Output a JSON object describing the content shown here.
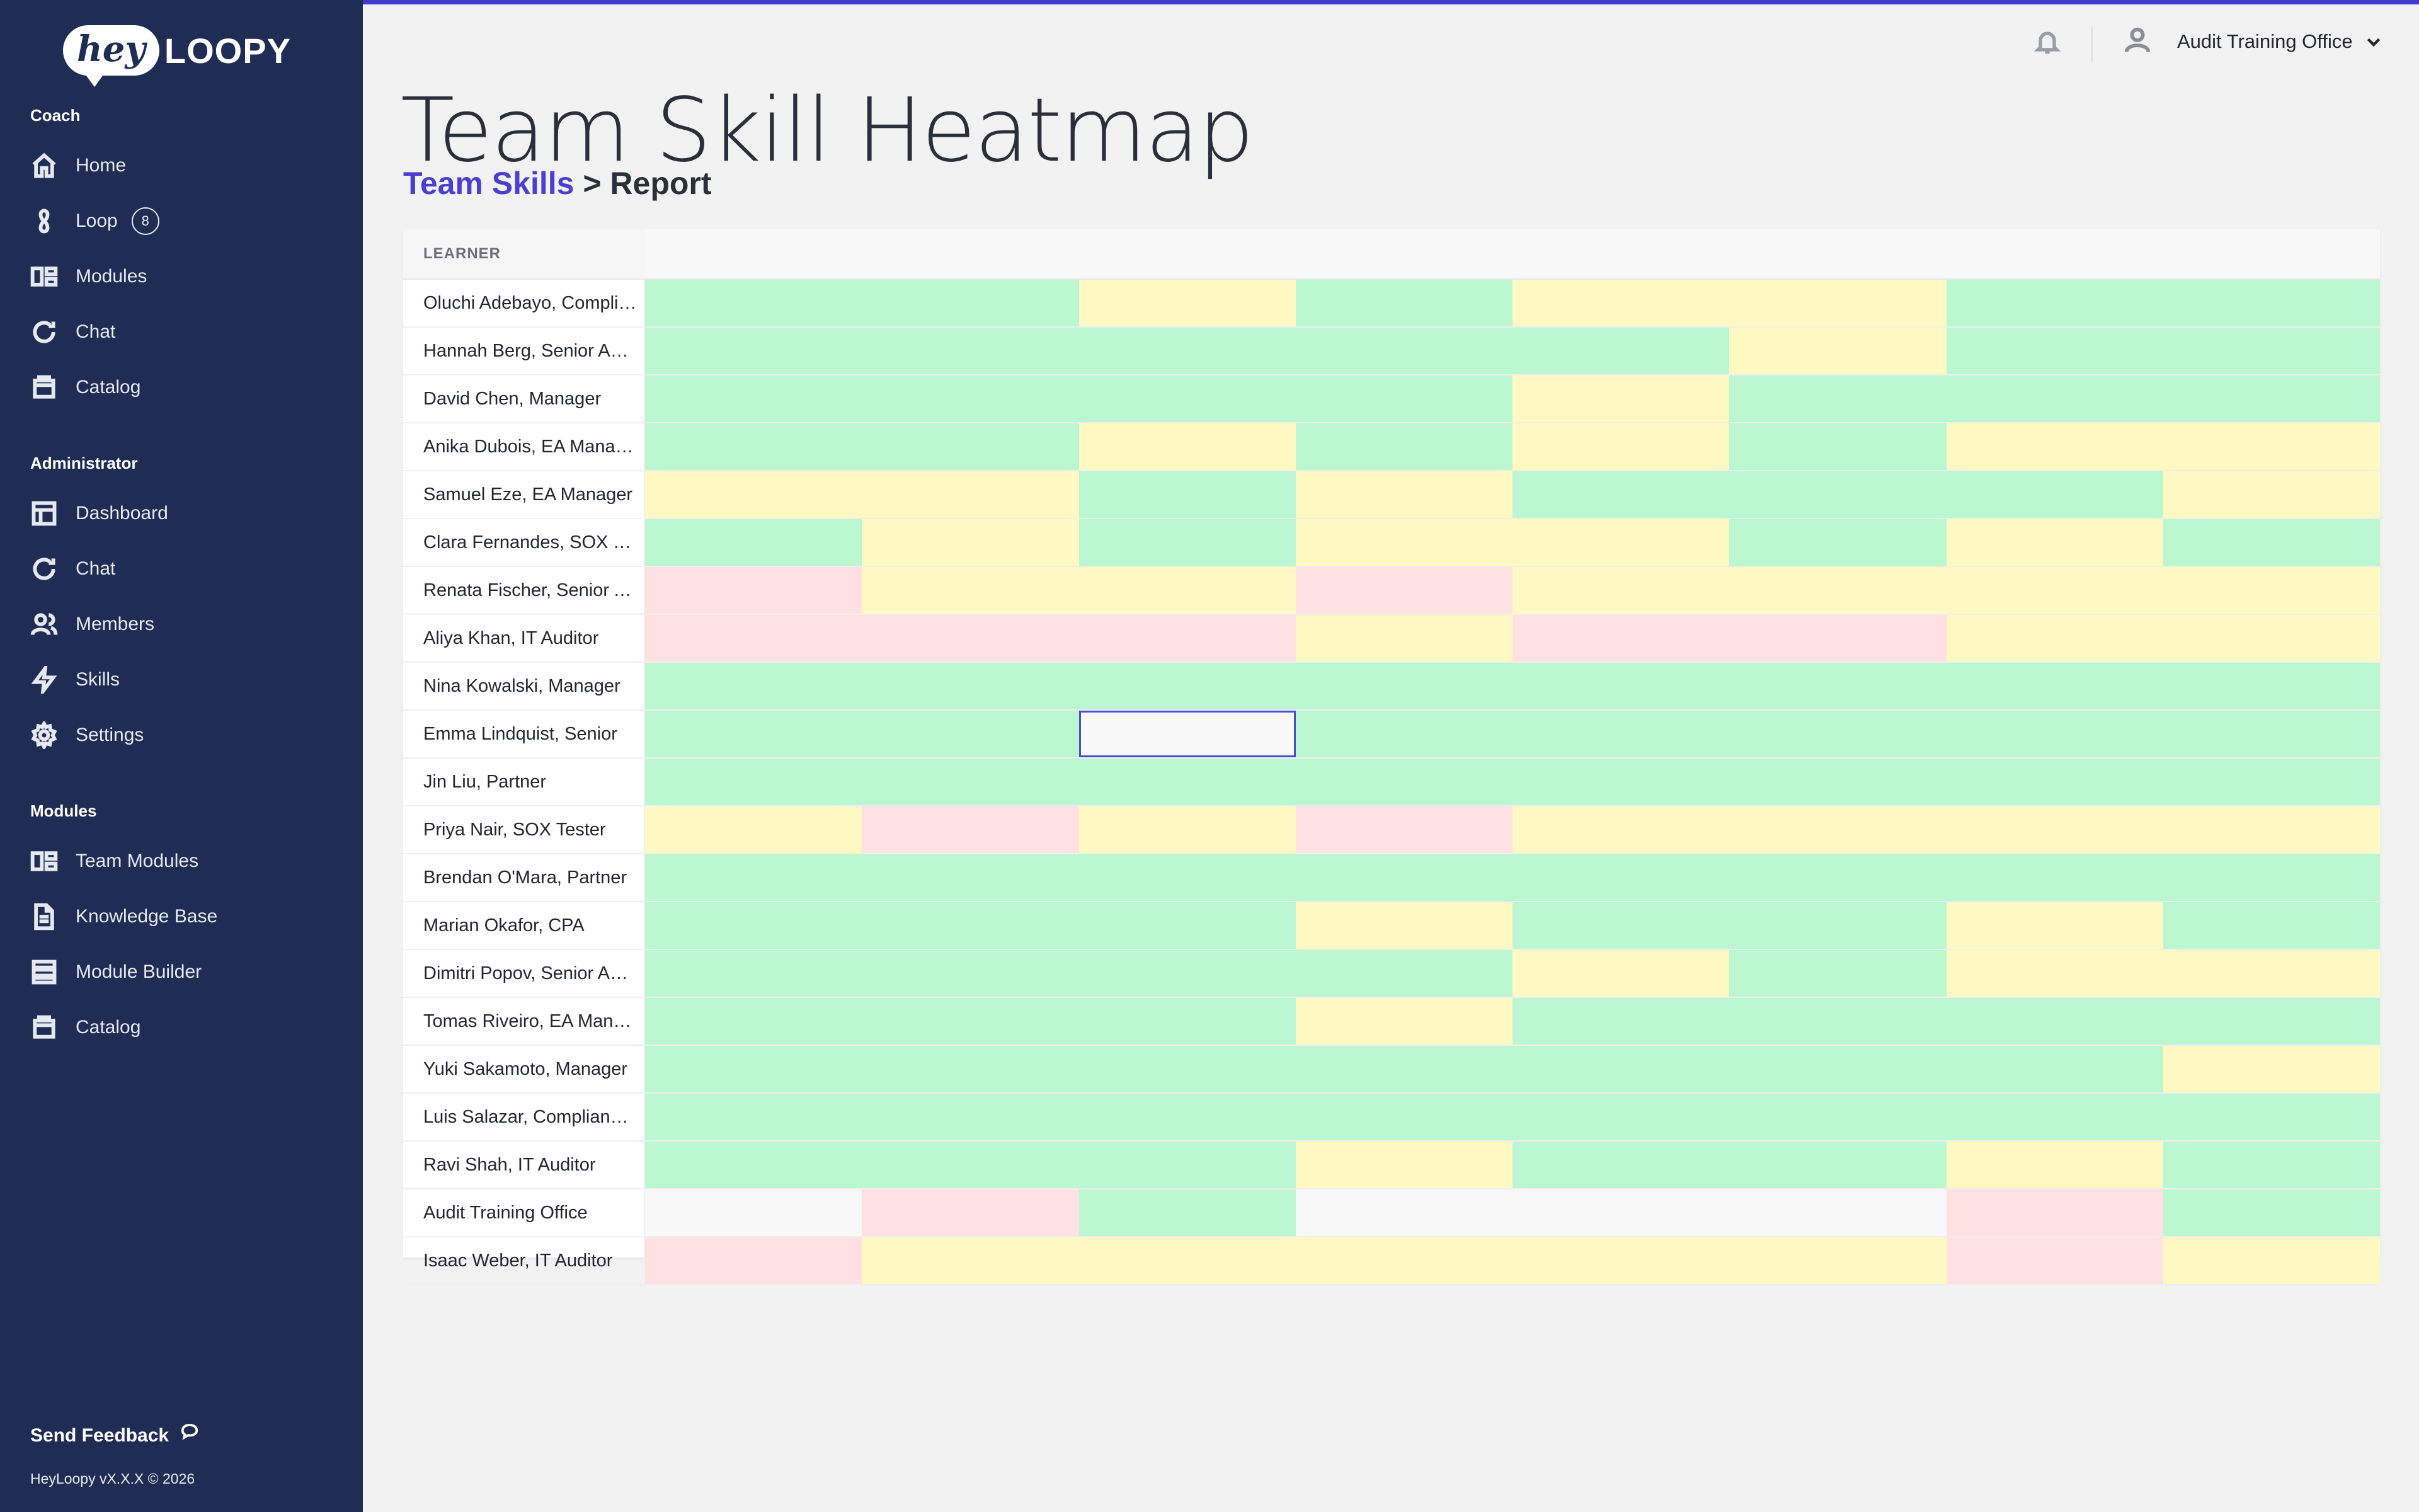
{
  "app": {
    "logo": {
      "hey": "hey",
      "loopy": "LOOPY"
    },
    "accent_color": "#3f3cc9",
    "sidebar_bg": "#1f2d55"
  },
  "sidebar": {
    "sections": [
      {
        "label": "Coach",
        "items": [
          {
            "label": "Home",
            "icon": "home-icon"
          },
          {
            "label": "Loop",
            "icon": "loop-icon",
            "badge": "8"
          },
          {
            "label": "Modules",
            "icon": "modules-icon"
          },
          {
            "label": "Chat",
            "icon": "chat-icon"
          },
          {
            "label": "Catalog",
            "icon": "catalog-icon"
          }
        ]
      },
      {
        "label": "Administrator",
        "items": [
          {
            "label": "Dashboard",
            "icon": "dashboard-icon"
          },
          {
            "label": "Chat",
            "icon": "chat-icon"
          },
          {
            "label": "Members",
            "icon": "members-icon"
          },
          {
            "label": "Skills",
            "icon": "lightning-icon"
          },
          {
            "label": "Settings",
            "icon": "gear-icon"
          }
        ]
      },
      {
        "label": "Modules",
        "items": [
          {
            "label": "Team Modules",
            "icon": "modules-icon"
          },
          {
            "label": "Knowledge Base",
            "icon": "document-icon"
          },
          {
            "label": "Module Builder",
            "icon": "builder-icon"
          },
          {
            "label": "Catalog",
            "icon": "catalog-icon"
          }
        ]
      }
    ],
    "feedback": "Send Feedback",
    "version": "HeyLoopy vX.X.X © 2026"
  },
  "topbar": {
    "org_name": "Audit Training Office",
    "bell_icon": "bell-icon",
    "user_icon": "user-icon"
  },
  "page": {
    "title": "Team Skill Heatmap",
    "breadcrumb_link": "Team Skills",
    "breadcrumb_sep": " > ",
    "breadcrumb_current": "Report"
  },
  "heatmap": {
    "learner_header": "LEARNER",
    "legend_colors": {
      "g": "#bbf7d0",
      "y": "#fef9c3",
      "r": "#ffe0e3",
      "n": "#f8f8f9"
    },
    "column_count": 8,
    "selected_cell": {
      "row": 9,
      "col": 2
    },
    "rows": [
      {
        "name": "Oluchi Adebayo, Compliance Manager",
        "levels": [
          "g",
          "g",
          "y",
          "g",
          "y",
          "y",
          "g",
          "g"
        ]
      },
      {
        "name": "Hannah Berg, Senior Auditor",
        "levels": [
          "g",
          "g",
          "g",
          "g",
          "g",
          "y",
          "g",
          "g"
        ]
      },
      {
        "name": "David Chen, Manager",
        "levels": [
          "g",
          "g",
          "g",
          "g",
          "y",
          "g",
          "g",
          "g"
        ]
      },
      {
        "name": "Anika Dubois, EA Manager",
        "levels": [
          "g",
          "g",
          "y",
          "g",
          "y",
          "g",
          "y",
          "y"
        ]
      },
      {
        "name": "Samuel Eze, EA Manager",
        "levels": [
          "y",
          "y",
          "g",
          "y",
          "g",
          "g",
          "g",
          "y"
        ]
      },
      {
        "name": "Clara Fernandes, SOX Tester",
        "levels": [
          "g",
          "y",
          "g",
          "y",
          "y",
          "g",
          "y",
          "g"
        ]
      },
      {
        "name": "Renata Fischer, Senior Auditor",
        "levels": [
          "r",
          "y",
          "y",
          "r",
          "y",
          "y",
          "y",
          "y"
        ]
      },
      {
        "name": "Aliya Khan, IT Auditor",
        "levels": [
          "r",
          "r",
          "r",
          "y",
          "r",
          "r",
          "y",
          "y"
        ]
      },
      {
        "name": "Nina Kowalski, Manager",
        "levels": [
          "g",
          "g",
          "g",
          "g",
          "g",
          "g",
          "g",
          "g"
        ]
      },
      {
        "name": "Emma Lindquist, Senior",
        "levels": [
          "g",
          "g",
          "n",
          "g",
          "g",
          "g",
          "g",
          "g"
        ]
      },
      {
        "name": "Jin Liu, Partner",
        "levels": [
          "g",
          "g",
          "g",
          "g",
          "g",
          "g",
          "g",
          "g"
        ]
      },
      {
        "name": "Priya Nair, SOX Tester",
        "levels": [
          "y",
          "r",
          "y",
          "r",
          "y",
          "y",
          "y",
          "y"
        ]
      },
      {
        "name": "Brendan O'Mara, Partner",
        "levels": [
          "g",
          "g",
          "g",
          "g",
          "g",
          "g",
          "g",
          "g"
        ]
      },
      {
        "name": "Marian Okafor, CPA",
        "levels": [
          "g",
          "g",
          "g",
          "y",
          "g",
          "g",
          "y",
          "g"
        ]
      },
      {
        "name": "Dimitri Popov, Senior Auditor",
        "levels": [
          "g",
          "g",
          "g",
          "g",
          "y",
          "g",
          "y",
          "y"
        ]
      },
      {
        "name": "Tomas Riveiro, EA Manager",
        "levels": [
          "g",
          "g",
          "g",
          "y",
          "g",
          "g",
          "g",
          "g"
        ]
      },
      {
        "name": "Yuki Sakamoto, Manager",
        "levels": [
          "g",
          "g",
          "g",
          "g",
          "g",
          "g",
          "g",
          "y"
        ]
      },
      {
        "name": "Luis Salazar, Compliance Manager",
        "levels": [
          "g",
          "g",
          "g",
          "g",
          "g",
          "g",
          "g",
          "g"
        ]
      },
      {
        "name": "Ravi Shah, IT Auditor",
        "levels": [
          "g",
          "g",
          "g",
          "y",
          "g",
          "g",
          "y",
          "g"
        ]
      },
      {
        "name": "Audit Training Office",
        "levels": [
          "n",
          "r",
          "g",
          "n",
          "n",
          "n",
          "r",
          "g"
        ]
      },
      {
        "name": "Isaac Weber, IT Auditor",
        "levels": [
          "r",
          "y",
          "y",
          "y",
          "y",
          "y",
          "r",
          "y"
        ]
      }
    ]
  }
}
